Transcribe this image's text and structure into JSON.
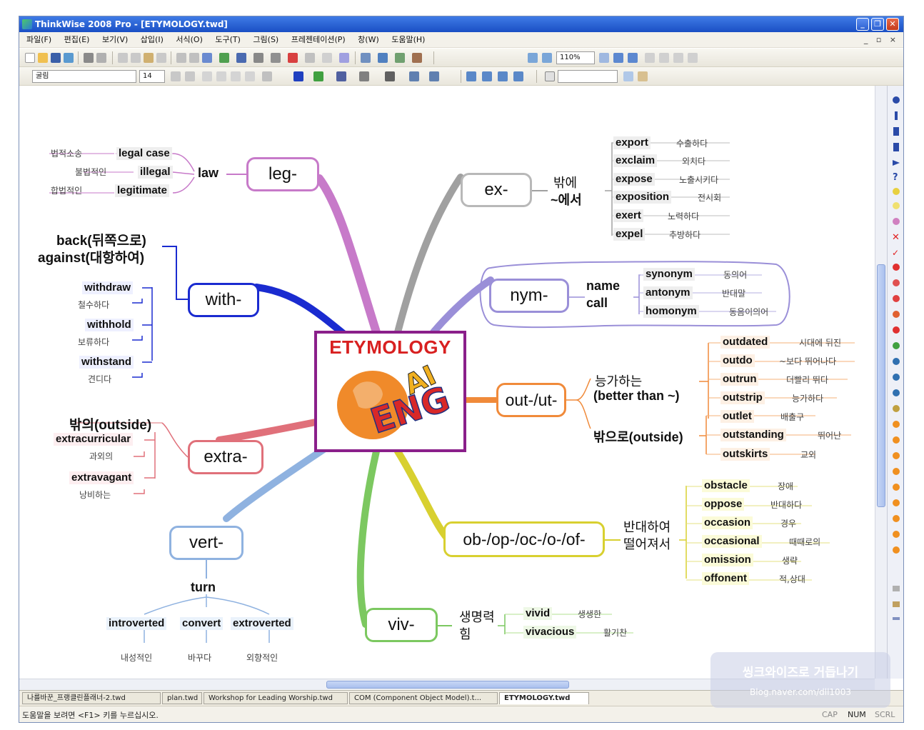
{
  "window": {
    "title": "ThinkWise 2008 Pro - [ETYMOLOGY.twd]",
    "controls": [
      "_",
      "❐",
      "✕"
    ]
  },
  "menu": [
    "파일(F)",
    "편집(E)",
    "보기(V)",
    "삽입(I)",
    "서식(O)",
    "도구(T)",
    "그림(S)",
    "프레젠테이션(P)",
    "창(W)",
    "도움말(H)"
  ],
  "menu_mdi": "_ ▫ ×",
  "toolbar": {
    "zoom": "110%",
    "font_name": "굴림",
    "font_size": "14"
  },
  "center": {
    "title": "ETYMOLOGY",
    "logo_text": [
      "ENG",
      "AI"
    ]
  },
  "branches": {
    "leg": {
      "root": "leg-",
      "meaning": "law",
      "words": [
        {
          "kr": "법적소송",
          "en": "legal case"
        },
        {
          "kr": "불법적인",
          "en": "illegal"
        },
        {
          "kr": "합법적인",
          "en": "legitimate"
        }
      ]
    },
    "with": {
      "root": "with-",
      "meaning1": "back(뒤쪽으로)",
      "meaning2": "against(대항하여)",
      "words": [
        {
          "en": "withdraw",
          "kr": "철수하다"
        },
        {
          "en": "withhold",
          "kr": "보류하다"
        },
        {
          "en": "withstand",
          "kr": "견디다"
        }
      ]
    },
    "extra": {
      "root": "extra-",
      "meaning": "밖의(outside)",
      "words": [
        {
          "en": "extracurricular",
          "kr": "과외의"
        },
        {
          "en": "extravagant",
          "kr": "낭비하는"
        }
      ]
    },
    "vert": {
      "root": "vert-",
      "meaning": "turn",
      "words": [
        {
          "en": "introverted",
          "kr": "내성적인"
        },
        {
          "en": "convert",
          "kr": "바꾸다"
        },
        {
          "en": "extroverted",
          "kr": "외향적인"
        }
      ]
    },
    "ex": {
      "root": "ex-",
      "meaning1": "밖에",
      "meaning2": "~에서",
      "words": [
        {
          "en": "export",
          "kr": "수출하다"
        },
        {
          "en": "exclaim",
          "kr": "외치다"
        },
        {
          "en": "expose",
          "kr": "노출시키다"
        },
        {
          "en": "exposition",
          "kr": "전시회"
        },
        {
          "en": "exert",
          "kr": "노력하다"
        },
        {
          "en": "expel",
          "kr": "추방하다"
        }
      ]
    },
    "nym": {
      "root": "nym-",
      "meaning1": "name",
      "meaning2": "call",
      "words": [
        {
          "en": "synonym",
          "kr": "동의어"
        },
        {
          "en": "antonym",
          "kr": "반대말"
        },
        {
          "en": "homonym",
          "kr": "동음이의어"
        }
      ]
    },
    "out": {
      "root": "out-/ut-",
      "meaning1a": "능가하는",
      "meaning1b": "(better than ~)",
      "meaning2": "밖으로(outside)",
      "words1": [
        {
          "en": "outdated",
          "kr": "시대에 뒤진"
        },
        {
          "en": "outdo",
          "kr": "~보다 뛰어나다"
        },
        {
          "en": "outrun",
          "kr": "더빨리 뛰다"
        },
        {
          "en": "outstrip",
          "kr": "능가하다"
        }
      ],
      "words2": [
        {
          "en": "outlet",
          "kr": "배출구"
        },
        {
          "en": "outstanding",
          "kr": "뛰어난"
        },
        {
          "en": "outskirts",
          "kr": "교외"
        }
      ]
    },
    "ob": {
      "root": "ob-/op-/oc-/o-/of-",
      "meaning1": "반대하여",
      "meaning2": "떨어져서",
      "words": [
        {
          "en": "obstacle",
          "kr": "장애"
        },
        {
          "en": "oppose",
          "kr": "반대하다"
        },
        {
          "en": "occasion",
          "kr": "경우"
        },
        {
          "en": "occasional",
          "kr": "때때로의"
        },
        {
          "en": "omission",
          "kr": "생략"
        },
        {
          "en": "offonent",
          "kr": "적,상대"
        }
      ]
    },
    "viv": {
      "root": "viv-",
      "meaning1": "생명력",
      "meaning2": "힘",
      "words": [
        {
          "en": "vivid",
          "kr": "생생한"
        },
        {
          "en": "vivacious",
          "kr": "활기찬"
        }
      ]
    }
  },
  "tabs": [
    "나를바꾼_프랭클린플래너-2.twd",
    "plan.twd",
    "Workshop for  Leading Worship.twd",
    "COM (Component Object Model).t...",
    "ETYMOLOGY.twd"
  ],
  "status": {
    "hint": "도움말을 보려면 <F1> 키를 누르십시오.",
    "cap": "CAP",
    "num": "NUM",
    "scrl": "SCRL"
  },
  "watermark": {
    "line1": "씽크와이즈로 거듭나기",
    "line2": "Blog.naver.com/dll1003"
  },
  "colors": {
    "title_bar": "#2458d4",
    "leg": "#c77ac9",
    "with": "#1a2bd0",
    "extra": "#e0707a",
    "vert": "#8fb2e0",
    "ex": "#a0a0a0",
    "nym": "#9a8fd8",
    "out": "#f08a3a",
    "ob": "#d8d030",
    "viv": "#7cc860",
    "center_border": "#8a1f8a",
    "center_title": "#d82020"
  }
}
